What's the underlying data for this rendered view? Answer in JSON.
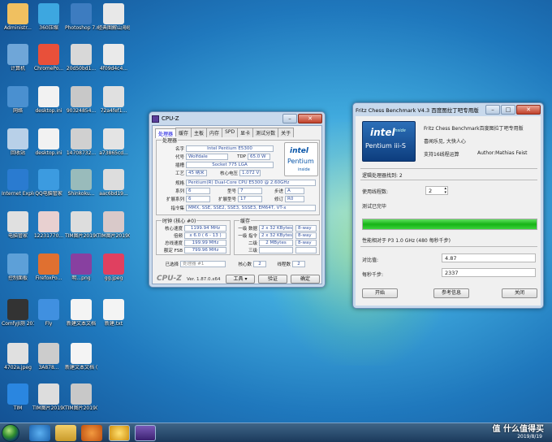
{
  "desktop": {
    "icons": [
      {
        "label": "Administr...",
        "color": "#f0c060"
      },
      {
        "label": "360压缩",
        "color": "#3da7e0"
      },
      {
        "label": "Photoshop 7.0",
        "color": "#3d7cc0"
      },
      {
        "label": "经典图解山海经：图...",
        "color": "#e8e8e8"
      },
      {
        "label": "计算机",
        "color": "#6fa6d8"
      },
      {
        "label": "ChromePo...",
        "color": "#e8503a"
      },
      {
        "label": "20d50bd1...",
        "color": "#d8d8d8"
      },
      {
        "label": "4f09d4c4...",
        "color": "#eaeaea"
      },
      {
        "label": "网络",
        "color": "#4a90d0"
      },
      {
        "label": "desktop.ini",
        "color": "#f2f2f2"
      },
      {
        "label": "90324854...",
        "color": "#c8c8c8"
      },
      {
        "label": "72a4fef1...",
        "color": "#e0e0e0"
      },
      {
        "label": "回收站",
        "color": "#b8d0e8"
      },
      {
        "label": "desktop.ini",
        "color": "#f2f2f2"
      },
      {
        "label": "14708732...",
        "color": "#d0d0d0"
      },
      {
        "label": "a73865cd...",
        "color": "#e4e4e4"
      },
      {
        "label": "Internet Explorer",
        "color": "#2a7bd0"
      },
      {
        "label": "QQ电脑管家",
        "color": "#3c9be0"
      },
      {
        "label": "Shinkoku...",
        "color": "#9bb"
      },
      {
        "label": "aac6bd19...",
        "color": "#ddd"
      },
      {
        "label": "电脑管家",
        "color": "#e0e0e0"
      },
      {
        "label": "12231770...",
        "color": "#e8d0d0"
      },
      {
        "label": "TIM图片20190818...",
        "color": "#ddd"
      },
      {
        "label": "TIM图片20190818...",
        "color": "#d9c9c9"
      },
      {
        "label": "控制面板",
        "color": "#5da0d8"
      },
      {
        "label": "FirefoxPo...",
        "color": "#e07030"
      },
      {
        "label": "明...png",
        "color": "#8840a0"
      },
      {
        "label": "gg.jpeg",
        "color": "#e04060"
      },
      {
        "label": "ComfyJI测 2019",
        "color": "#333"
      },
      {
        "label": "Fly",
        "color": "#4090e0"
      },
      {
        "label": "新建文本文档",
        "color": "#f4f4f4"
      },
      {
        "label": "新建.txt",
        "color": "#f4f4f4"
      },
      {
        "label": "4702a.jpeg",
        "color": "#e0e0e0"
      },
      {
        "label": "3A878...",
        "color": "#ccc"
      },
      {
        "label": "新建文本文档 (2).txt",
        "color": "#f4f4f4"
      },
      {
        "label": "TIM",
        "color": "#2a86e0"
      },
      {
        "label": "TIM图片20190818...",
        "color": "#ddd"
      },
      {
        "label": "TIM图片20190818...",
        "color": "#c8c8c8"
      }
    ]
  },
  "cpuz": {
    "title": "CPU-Z",
    "tabs": [
      "处理器",
      "缓存",
      "主板",
      "内存",
      "SPD",
      "显卡",
      "测试分数",
      "关于"
    ],
    "processor_group": "处理器",
    "name_label": "名字",
    "name": "Intel Pentium E5300",
    "code_label": "代号",
    "code": "Wolfdale",
    "tdp_label": "TDP",
    "tdp": "65.0 W",
    "socket_label": "插槽",
    "socket": "Socket 775 LGA",
    "tech_label": "工艺",
    "tech": "45 纳米",
    "vcore_label": "核心电压",
    "vcore": "1.072 V",
    "spec_label": "规格",
    "spec": "Pentium(R) Dual-Core CPU    E5300 @ 2.60GHz",
    "family_label": "系列",
    "family": "6",
    "model_label": "型号",
    "model": "7",
    "stepping_label": "步进",
    "stepping": "A",
    "extfamily_label": "扩展系列",
    "extfamily": "6",
    "extmodel_label": "扩展型号",
    "extmodel": "17",
    "revision_label": "修订",
    "revision": "R0",
    "instr_label": "指令集",
    "instr": "MMX, SSE, SSE2, SSE3, SSSE3, EM64T, VT-x",
    "clock_group": "时钟 (核心 #0)",
    "corespeed_label": "核心速度",
    "corespeed": "1199.94 MHz",
    "multiplier_label": "倍频",
    "multiplier": "x 6.0 ( 6 - 13 )",
    "bus_label": "总线速度",
    "bus": "199.99 MHz",
    "fsb_label": "额定 FSB",
    "fsb": "799.96 MHz",
    "cache_group": "缓存",
    "l1d_label": "一级 数据",
    "l1d": "2 x 32 KBytes",
    "l1d_way": "8-way",
    "l1i_label": "一级 指令",
    "l1i": "2 x 32 KBytes",
    "l1i_way": "8-way",
    "l2_label": "二级",
    "l2": "2 MBytes",
    "l2_way": "8-way",
    "l3_label": "三级",
    "selected_label": "已选择",
    "selected": "处理器 #1",
    "cores_label": "核心数",
    "cores": "2",
    "threads_label": "线程数",
    "threads": "2",
    "logo": "CPU-Z",
    "version": "Ver. 1.87.0.x64",
    "tools_btn": "工具",
    "validate_btn": "验证",
    "ok_btn": "确定",
    "intel_word": "intel",
    "pentium_word": "Pentium",
    "inside_word": "inside"
  },
  "fritz": {
    "title": "Fritz Chess Benchmark V4.3  百度图拉丁吧专用版",
    "header_title": "Fritz Chess Benchmark百度图拉丁吧专用版",
    "slogan": "喜闻乐见, 大快人心",
    "support": "支持16线程运算",
    "author": "Author:Mathias Feist",
    "logical_found": "逻辑处理器找到: 2",
    "threads_label": "使用线程数:",
    "threads_value": "2",
    "status": "测试已完毕",
    "progress": 1.0,
    "relative_label": "性能相对于 P3 1.0 GHz (480 每秒千步)",
    "ratio_label": "对比值:",
    "ratio": "4.87",
    "kns_label": "每秒千步:",
    "kns": "2337",
    "start_btn": "开始",
    "info_btn": "参考信息",
    "close_btn": "关闭",
    "intel_word": "intel",
    "pentium_word": "Pentium iii-S",
    "inside_word": "inside"
  },
  "taskbar": {
    "date": "2019/8/19",
    "watermark": "值 什么值得买"
  }
}
